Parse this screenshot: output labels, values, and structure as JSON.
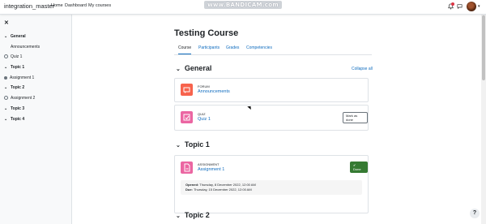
{
  "navbar": {
    "brand": "integration_master",
    "links": [
      "Home",
      "Dashboard",
      "My courses"
    ],
    "watermark": "www.BANDICAM.com"
  },
  "drawer": {
    "items": [
      {
        "label": "General",
        "kind": "section"
      },
      {
        "label": "Announcements",
        "kind": "activity"
      },
      {
        "label": "Quiz 1",
        "kind": "activity-incomplete"
      },
      {
        "label": "Topic 1",
        "kind": "section"
      },
      {
        "label": "Assignment 1",
        "kind": "activity-complete"
      },
      {
        "label": "Topic 2",
        "kind": "section"
      },
      {
        "label": "Assignment 2",
        "kind": "activity-incomplete"
      },
      {
        "label": "Topic 3",
        "kind": "section"
      },
      {
        "label": "Topic 4",
        "kind": "section"
      }
    ]
  },
  "course": {
    "title": "Testing Course",
    "tabs": [
      "Course",
      "Participants",
      "Grades",
      "Competencies"
    ],
    "collapse_all": "Collapse all",
    "sections": {
      "general": "General",
      "topic1": "Topic 1",
      "topic2": "Topic 2"
    },
    "activities": {
      "forum": {
        "type": "FORUM",
        "name": "Announcements"
      },
      "quiz": {
        "type": "QUIZ",
        "name": "Quiz 1",
        "button": "Mark as done"
      },
      "assignment": {
        "type": "ASSIGNMENT",
        "name": "Assignment 1",
        "button": "✔ Done",
        "opened_label": "Opened:",
        "opened_value": "Thursday, 8 December 2022, 12:00 AM",
        "due_label": "Due:",
        "due_value": "Thursday, 15 December 2022, 12:00 AM"
      }
    }
  },
  "help_label": "?",
  "colors": {
    "forum_icon": "#f7634d",
    "quiz_icon": "#eb66a2",
    "assignment_icon": "#eb66a2",
    "link": "#0f6cbf",
    "done_button": "#357a32"
  },
  "icons": [
    "bell-icon",
    "chat-icon",
    "close-icon",
    "chevron-down-icon",
    "forum-icon",
    "quiz-icon",
    "assignment-icon",
    "help-icon"
  ]
}
